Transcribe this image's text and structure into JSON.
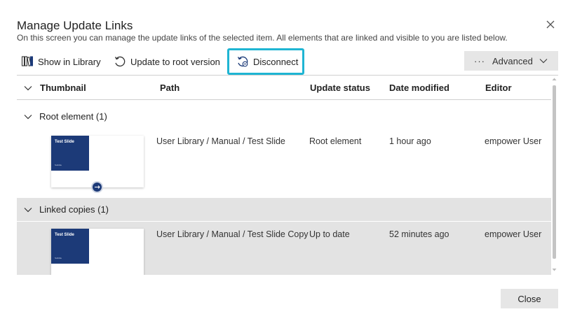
{
  "dialog": {
    "title": "Manage Update Links",
    "subtitle": "On this screen you can manage the update links of the selected item. All elements that are linked and visible to you are listed below."
  },
  "toolbar": {
    "show_in_library": "Show in Library",
    "update_to_root": "Update to root version",
    "disconnect": "Disconnect",
    "advanced": "Advanced",
    "advanced_dots": "···"
  },
  "table": {
    "headers": {
      "thumbnail": "Thumbnail",
      "path": "Path",
      "update_status": "Update status",
      "date_modified": "Date modified",
      "editor": "Editor"
    },
    "groups": [
      {
        "label": "Root element (1)",
        "rows": [
          {
            "slide_title": "Test Slide",
            "slide_subtitle": "Subtitle",
            "path": "User Library / Manual / Test Slide",
            "status": "Root element",
            "date": "1 hour ago",
            "editor": "empower User"
          }
        ]
      },
      {
        "label": "Linked copies (1)",
        "rows": [
          {
            "slide_title": "Test Slide",
            "slide_subtitle": "Subtitle",
            "path": "User Library / Manual / Test Slide Copy",
            "status": "Up to date",
            "date": "52 minutes ago",
            "editor": "empower User"
          }
        ]
      }
    ]
  },
  "footer": {
    "close_label": "Close"
  },
  "colors": {
    "accent": "#1fb5d3",
    "slide_blue": "#1c3a78",
    "selected_row": "#e3e3e3"
  }
}
